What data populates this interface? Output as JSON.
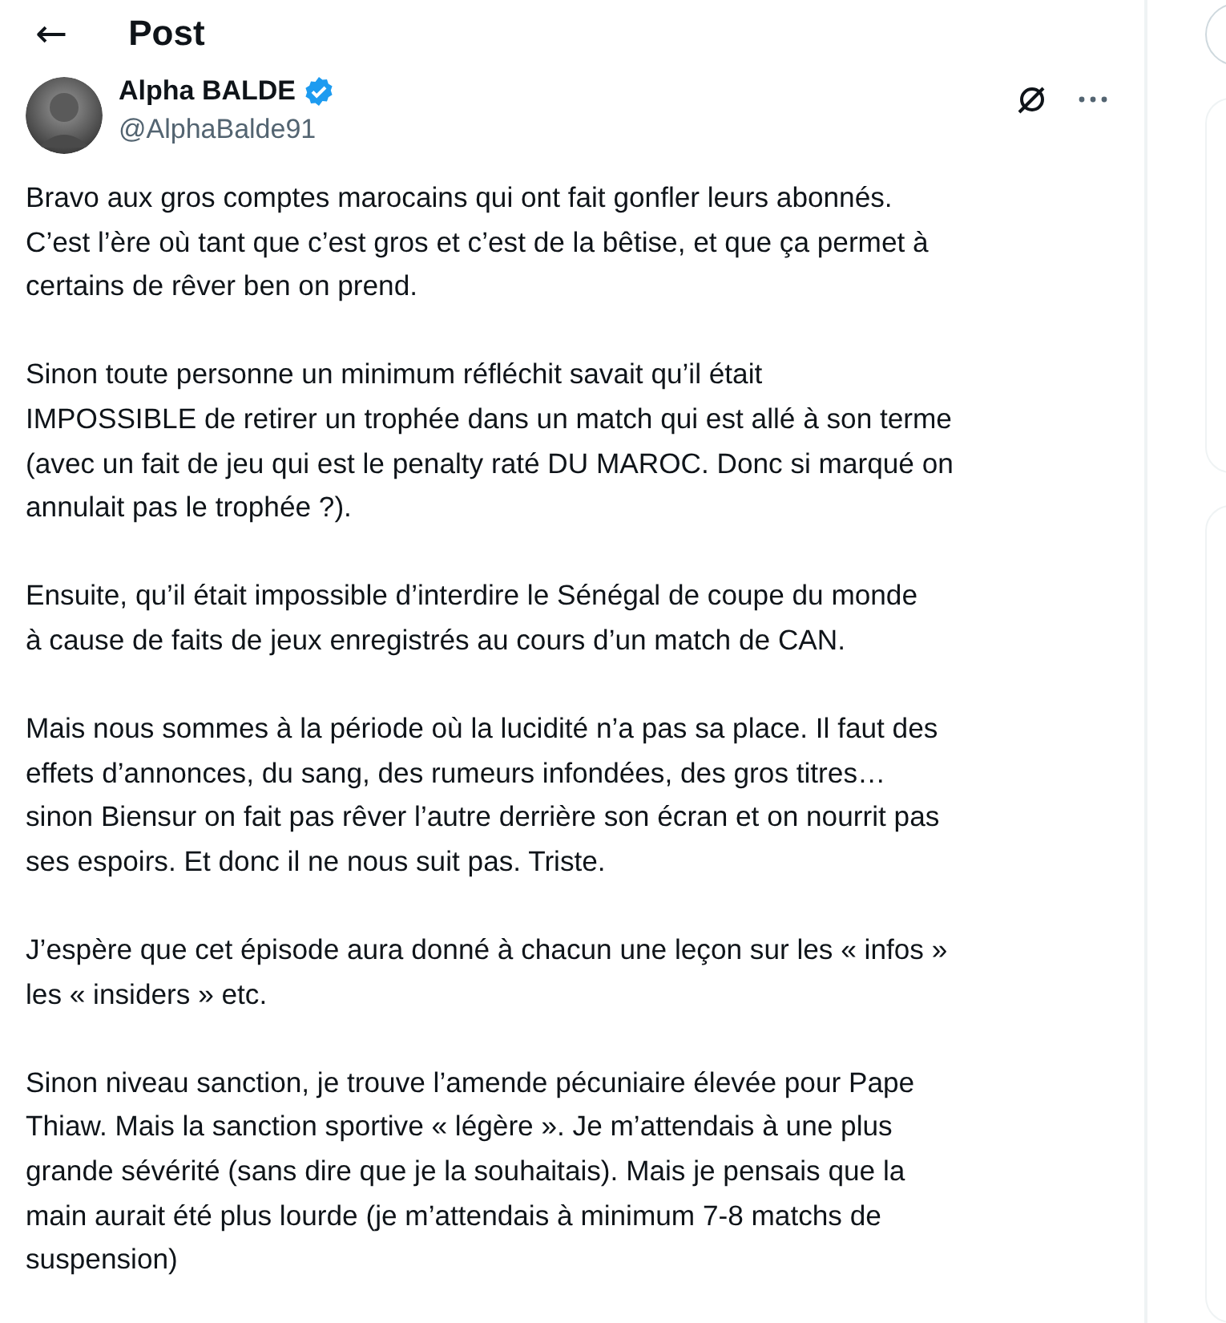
{
  "header": {
    "back_icon": "←",
    "title": "Post"
  },
  "post": {
    "author": {
      "name": "Alpha BALDE",
      "verified": true,
      "handle": "@AlphaBalde91"
    },
    "paragraphs": [
      "Bravo aux gros comptes marocains qui ont fait gonfler leurs abonnés.\nC’est l’ère où tant que c’est gros et c’est de la bêtise, et que ça permet à\ncertains de rêver ben on prend.",
      "Sinon toute personne un minimum réfléchit savait qu’il était\nIMPOSSIBLE de retirer un trophée dans un match qui est allé à son terme\n(avec un fait de jeu qui est le penalty raté DU MAROC. Donc si marqué on\nannulait pas le trophée ?).",
      "Ensuite, qu’il était impossible d’interdire le Sénégal de coupe du monde\nà cause de faits de jeux enregistrés au cours d’un match de CAN.",
      "Mais nous sommes à la période où la lucidité n’a pas sa place. Il faut des\neffets d’annonces, du sang, des rumeurs infondées, des gros titres…\nsinon Biensur on fait pas rêver l’autre derrière son écran et on nourrit pas\nses espoirs. Et donc il ne nous suit pas. Triste.",
      "J’espère que cet épisode aura donné à chacun une leçon sur les « infos »\nles « insiders » etc.",
      "Sinon niveau sanction, je trouve l’amende pécuniaire élevée pour Pape\nThiaw. Mais la sanction sportive « légère ». Je m’attendais à une plus\ngrande sévérité (sans dire que je la souhaitais). Mais je pensais que la\nmain aurait été plus lourde (je m’attendais à minimum 7-8 matchs de\nsuspension)"
    ]
  }
}
